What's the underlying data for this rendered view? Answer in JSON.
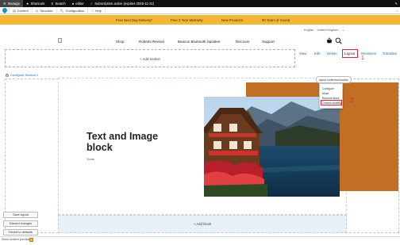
{
  "admin_toolbar": {
    "manage": "Manage",
    "shortcuts": "Shortcuts",
    "search": "Search",
    "user": "editor",
    "subscription": "Subscription active (expires 2025-11-21)"
  },
  "secondary_toolbar": {
    "content": "Content",
    "structure": "Structure",
    "configuration": "Configuration",
    "help": "Help"
  },
  "promo": [
    "Free Next Day Delivery*",
    "Free 2 Year Warranty",
    "New Products",
    "90 Years of Sound"
  ],
  "language": {
    "english": "English",
    "region": "United Kingdom"
  },
  "nav": [
    "Shop",
    "Roberts Revival",
    "Beacon Bluetooth Speaker",
    "Discover",
    "Support"
  ],
  "tabs": {
    "view": "View",
    "edit": "Edit",
    "delete": "Delete",
    "layout": "Layout",
    "revisions": "Revisions",
    "translate": "Translate"
  },
  "annotations": {
    "one": "1",
    "two": "2",
    "color": "#e8222e"
  },
  "layout_builder": {
    "add_section": "+ Add section",
    "configure_section": "Configure Section 1",
    "add_block": "+ Add block",
    "block_title": "Text and Image block",
    "block_body": "Some",
    "context_toggle": "layout contextual toolbar",
    "context_menu": [
      "Configure",
      "Move",
      "Remove block",
      "Content visibility"
    ]
  },
  "actions": {
    "save": "Save layout",
    "discard": "Discard changes",
    "revert": "Revert to defaults"
  },
  "preview": {
    "label": "Show content preview",
    "checked": true
  },
  "colors": {
    "promo": "#f5b731",
    "orange_panel": "#c06f24",
    "link": "#1a6bb8"
  }
}
